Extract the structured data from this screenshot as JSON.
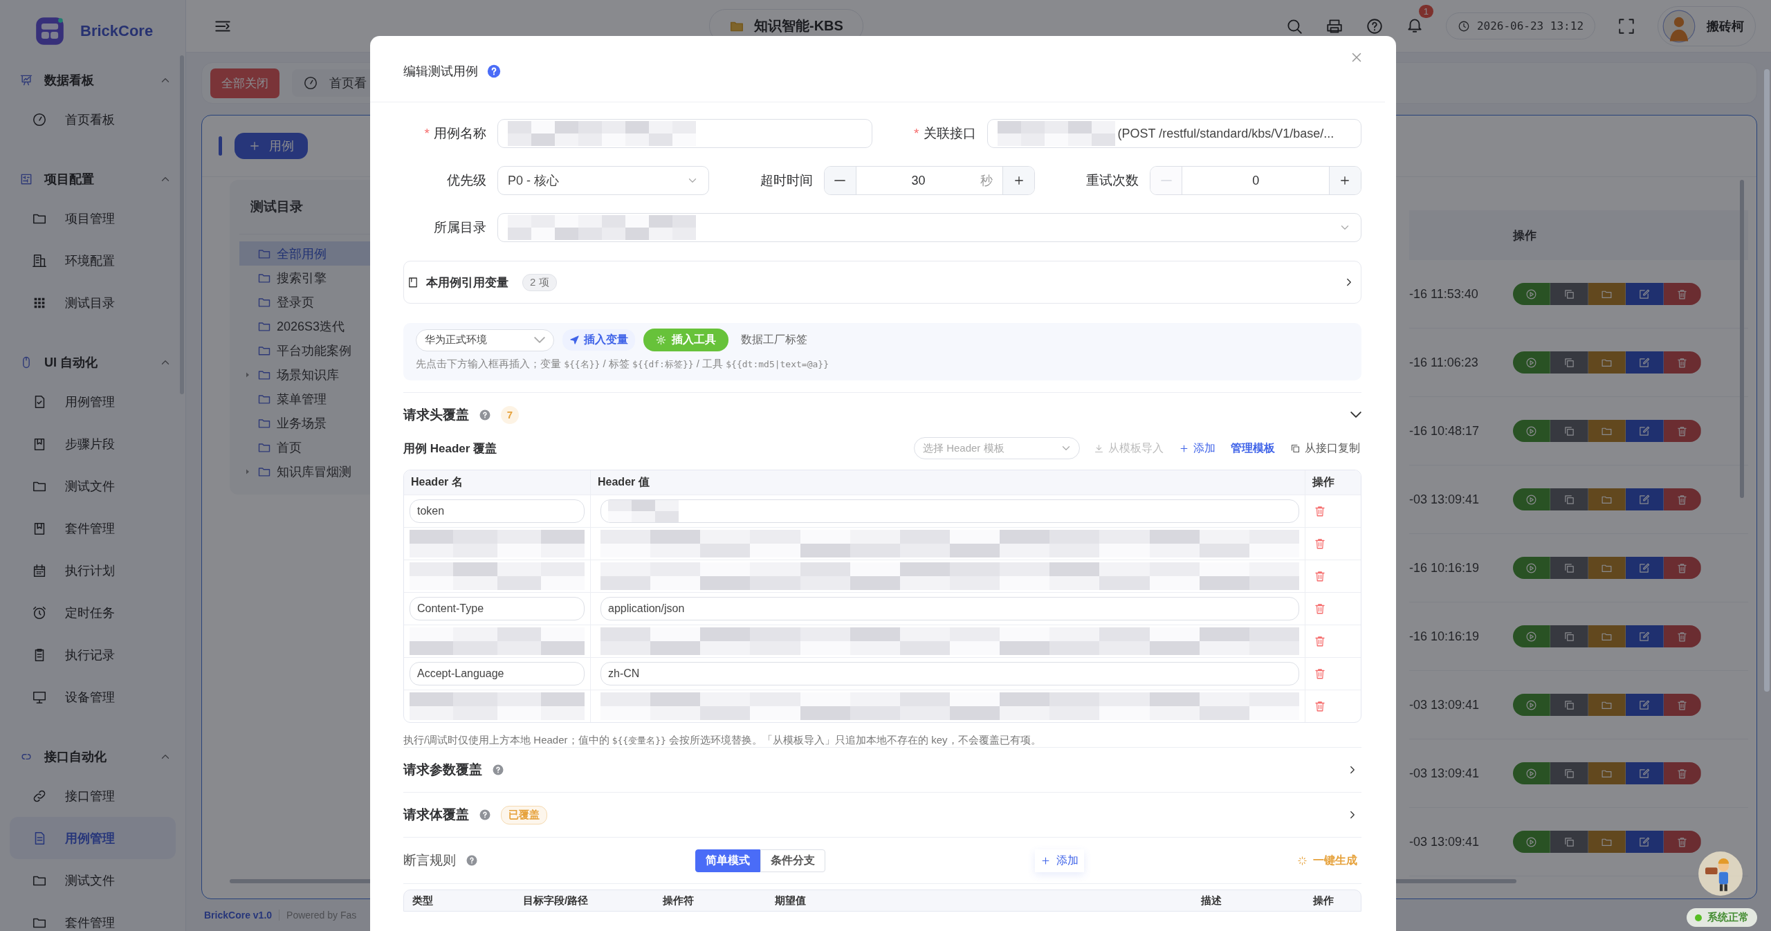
{
  "app": {
    "logo_text": "BrickCore"
  },
  "sidebar": {
    "sections": [
      {
        "title": "数据看板",
        "expanded": true,
        "items": [
          {
            "label": "首页看板",
            "selected": false
          }
        ]
      },
      {
        "title": "项目配置",
        "expanded": true,
        "items": [
          {
            "label": "项目管理",
            "selected": false
          },
          {
            "label": "环境配置",
            "selected": false
          },
          {
            "label": "测试目录",
            "selected": false
          }
        ]
      },
      {
        "title": "UI 自动化",
        "expanded": true,
        "items": [
          {
            "label": "用例管理",
            "selected": false
          },
          {
            "label": "步骤片段",
            "selected": false
          },
          {
            "label": "测试文件",
            "selected": false
          },
          {
            "label": "套件管理",
            "selected": false
          },
          {
            "label": "执行计划",
            "selected": false
          },
          {
            "label": "定时任务",
            "selected": false
          },
          {
            "label": "执行记录",
            "selected": false
          },
          {
            "label": "设备管理",
            "selected": false
          }
        ]
      },
      {
        "title": "接口自动化",
        "expanded": true,
        "items": [
          {
            "label": "接口管理",
            "selected": false
          },
          {
            "label": "用例管理",
            "selected": true
          },
          {
            "label": "测试文件",
            "selected": false
          },
          {
            "label": "套件管理",
            "selected": false
          }
        ]
      }
    ]
  },
  "topbar": {
    "project": "知识智能-KBS",
    "notification_count": "1",
    "datetime": "2026-06-23 13:12",
    "user": "搬砖柯"
  },
  "tabs": {
    "close_all": "全部关闭",
    "items": [
      {
        "label": "首页看",
        "selected": false
      }
    ]
  },
  "toolbar": {
    "add_button": "用例"
  },
  "tree": {
    "title": "测试目录",
    "items": [
      {
        "label": "全部用例",
        "selected": true,
        "has_children": false
      },
      {
        "label": "搜索引擎",
        "selected": false,
        "has_children": false
      },
      {
        "label": "登录页",
        "selected": false,
        "has_children": false
      },
      {
        "label": "2026S3迭代",
        "selected": false,
        "has_children": false
      },
      {
        "label": "平台功能案例",
        "selected": false,
        "has_children": false
      },
      {
        "label": "场景知识库",
        "selected": false,
        "has_children": true
      },
      {
        "label": "菜单管理",
        "selected": false,
        "has_children": false
      },
      {
        "label": "业务场景",
        "selected": false,
        "has_children": false
      },
      {
        "label": "首页",
        "selected": false,
        "has_children": false
      },
      {
        "label": "知识库冒烟测",
        "selected": false,
        "has_children": true
      }
    ]
  },
  "table": {
    "columns": [
      "操作"
    ],
    "rows": [
      {
        "time": "-16 11:53:40"
      },
      {
        "time": "-16 11:06:23"
      },
      {
        "time": "-16 10:48:17"
      },
      {
        "time": "-03 13:09:41"
      },
      {
        "time": "-16 10:16:19"
      },
      {
        "time": "-16 10:16:19"
      },
      {
        "time": "-03 13:09:41"
      },
      {
        "time": "-03 13:09:41"
      },
      {
        "time": "-03 13:09:41"
      }
    ]
  },
  "footer": {
    "brand": "BrickCore v1.0",
    "powered": "Powered by Fas"
  },
  "status": {
    "label": "系统正常",
    "healthy": true
  },
  "modal": {
    "title": "编辑测试用例",
    "form_rows": [
      [
        {
          "kind": "text",
          "label": "用例名称",
          "required_mark": "*",
          "redacted": true
        },
        {
          "kind": "text",
          "label": "关联接口",
          "required_mark": "*",
          "redacted": true,
          "value": "(POST /restful/standard/kbs/V1/base/..."
        }
      ],
      [
        {
          "kind": "select",
          "label": "优先级",
          "value": "P0 - 核心"
        },
        {
          "kind": "number",
          "label": "超时时间",
          "value": "30",
          "unit": "秒",
          "minus_disabled": false
        },
        {
          "kind": "number",
          "label": "重试次数",
          "value": "0",
          "minus_disabled": true
        }
      ],
      [
        {
          "kind": "select",
          "label": "所属目录",
          "redacted": true
        }
      ]
    ],
    "variables": {
      "title": "本用例引用变量",
      "count": "2 项",
      "expanded": false
    },
    "insert_bar": {
      "environment": "华为正式环境",
      "insert_var": "插入变量",
      "insert_tool": "插入工具",
      "tag_label": "数据工厂标签",
      "hint": [
        {
          "kind": "text",
          "text": "先点击下方输入框再插入；变量 "
        },
        {
          "kind": "code",
          "text": "${{名}}"
        },
        {
          "kind": "text",
          "text": " / 标签 "
        },
        {
          "kind": "code",
          "text": "${{df:标签}}"
        },
        {
          "kind": "text",
          "text": " / 工具 "
        },
        {
          "kind": "code",
          "text": "${{dt:md5|text=@a}}"
        }
      ]
    },
    "headers": {
      "title": "请求头覆盖",
      "count": "7",
      "expanded": true,
      "subtitle": "用例 Header 覆盖",
      "template_placeholder": "选择 Header 模板",
      "actions": [
        {
          "kind": "import",
          "label": "从模板导入",
          "disabled": true
        },
        {
          "kind": "add",
          "label": "添加",
          "disabled": false
        },
        {
          "kind": "manage",
          "label": "管理模板",
          "disabled": false
        },
        {
          "kind": "copy",
          "label": "从接口复制",
          "disabled": false
        }
      ],
      "columns": [
        "Header 名",
        "Header 值",
        "操作"
      ],
      "rows": [
        {
          "kind": "plain",
          "name": "token"
        },
        {
          "kind": "redacted"
        },
        {
          "kind": "redacted"
        },
        {
          "kind": "plain",
          "name": "Content-Type",
          "value": "application/json"
        },
        {
          "kind": "redacted"
        },
        {
          "kind": "plain",
          "name": "Accept-Language",
          "value": "zh-CN"
        },
        {
          "kind": "redacted"
        }
      ],
      "note": [
        {
          "kind": "text",
          "text": "执行/调试时仅使用上方本地 Header；值中的 "
        },
        {
          "kind": "code",
          "text": "${{变量名}}"
        },
        {
          "kind": "text",
          "text": " 会按所选环境替换。「从模板导入」只追加本地不存在的 key，不会覆盖已有项。"
        }
      ]
    },
    "params": {
      "title": "请求参数覆盖",
      "expanded": false
    },
    "body": {
      "title": "请求体覆盖",
      "tag": "已覆盖",
      "expanded": false
    },
    "assertions": {
      "title": "断言规则",
      "modes": [
        {
          "label": "简单模式",
          "selected": true
        },
        {
          "label": "条件分支",
          "selected": false
        }
      ],
      "add": "添加",
      "generate": "一键生成",
      "columns": [
        "类型",
        "目标字段/路径",
        "操作符",
        "期望值",
        "描述",
        "操作"
      ]
    }
  }
}
